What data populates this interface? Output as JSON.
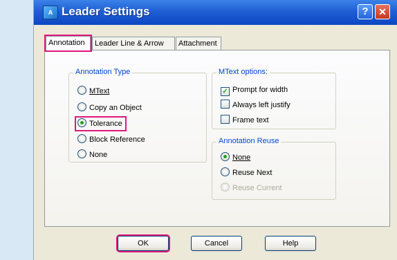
{
  "window": {
    "title": "Leader Settings",
    "icon_name": "app-icon",
    "help_glyph": "?",
    "close_glyph": "✕"
  },
  "tabs": [
    {
      "label": "Annotation",
      "active": true
    },
    {
      "label": "Leader Line & Arrow",
      "active": false
    },
    {
      "label": "Attachment",
      "active": false
    }
  ],
  "annotation_type": {
    "legend": "Annotation Type",
    "options": [
      {
        "label": "MText",
        "checked": false
      },
      {
        "label": "Copy an Object",
        "checked": false
      },
      {
        "label": "Tolerance",
        "checked": true
      },
      {
        "label": "Block Reference",
        "checked": false
      },
      {
        "label": "None",
        "checked": false
      }
    ]
  },
  "mtext_options": {
    "legend": "MText options:",
    "items": [
      {
        "label": "Prompt for width",
        "checked": true
      },
      {
        "label": "Always left justify",
        "checked": false
      },
      {
        "label": "Frame text",
        "checked": false
      }
    ]
  },
  "annotation_reuse": {
    "legend": "Annotation Reuse",
    "options": [
      {
        "label": "None",
        "checked": true,
        "enabled": true
      },
      {
        "label": "Reuse Next",
        "checked": false,
        "enabled": true
      },
      {
        "label": "Reuse Current",
        "checked": false,
        "enabled": false
      }
    ]
  },
  "buttons": {
    "ok": "OK",
    "cancel": "Cancel",
    "help": "Help"
  },
  "colors": {
    "highlight": "#e0177c",
    "title_bar": "#1f5fd4",
    "group_label": "#0046d5",
    "check_mark": "#21a121"
  }
}
